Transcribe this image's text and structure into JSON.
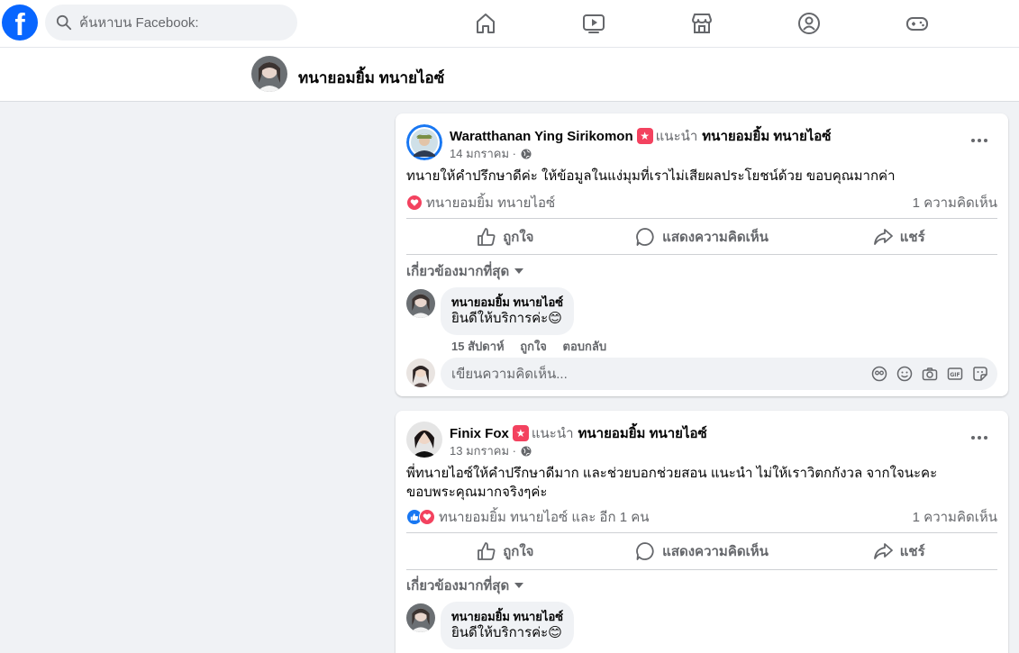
{
  "topbar": {
    "logo": "f",
    "search_placeholder": "ค้นหาบน Facebook:",
    "nav_icons": [
      "home-icon",
      "video-icon",
      "marketplace-icon",
      "groups-icon",
      "gaming-icon"
    ]
  },
  "page": {
    "name": "ทนายอมยิ้ม ทนายไอซ์"
  },
  "posts": [
    {
      "author": "Waratthanan Ying Sirikomon",
      "recommends": "แนะนำ",
      "target": "ทนายอมยิ้ม ทนายไอซ์",
      "date": "14 มกราคม ·",
      "text": "ทนายให้คำปรึกษาดีค่ะ ให้ข้อมูลในแง่มุมที่เราไม่เสียผลประโยชน์ด้วย ขอบคุณมากค่า",
      "reactions_text": "ทนายอมยิ้ม ทนายไอซ์",
      "comment_count": "1 ความคิดเห็น",
      "actions": {
        "like": "ถูกใจ",
        "comment": "แสดงความคิดเห็น",
        "share": "แชร์"
      },
      "filter": "เกี่ยวข้องมากที่สุด",
      "comment": {
        "name": "ทนายอมยิ้ม ทนายไอซ์",
        "text": "ยินดีให้บริการค่ะ😊",
        "time": "15 สัปดาห์",
        "like": "ถูกใจ",
        "reply": "ตอบกลับ"
      },
      "write_placeholder": "เขียนความคิดเห็น..."
    },
    {
      "author": "Finix Fox",
      "recommends": "แนะนำ",
      "target": "ทนายอมยิ้ม ทนายไอซ์",
      "date": "13 มกราคม ·",
      "text": "พี่ทนายไอซ์ให้คำปรึกษาดีมาก และช่วยบอกช่วยสอน แนะนำ ไม่ให้เราวิตกกังวล จากใจนะคะ ขอบพระคุณมากจริงๆค่ะ",
      "reactions_text": "ทนายอมยิ้ม ทนายไอซ์ และ อีก 1 คน",
      "comment_count": "1 ความคิดเห็น",
      "actions": {
        "like": "ถูกใจ",
        "comment": "แสดงความคิดเห็น",
        "share": "แชร์"
      },
      "filter": "เกี่ยวข้องมากที่สุด",
      "comment": {
        "name": "ทนายอมยิ้ม ทนายไอซ์",
        "text": "ยินดีให้บริการค่ะ😊"
      }
    }
  ],
  "colors": {
    "brand": "#0866ff",
    "love": "#f3425f",
    "muted": "#65676b",
    "bg": "#f0f2f5"
  }
}
